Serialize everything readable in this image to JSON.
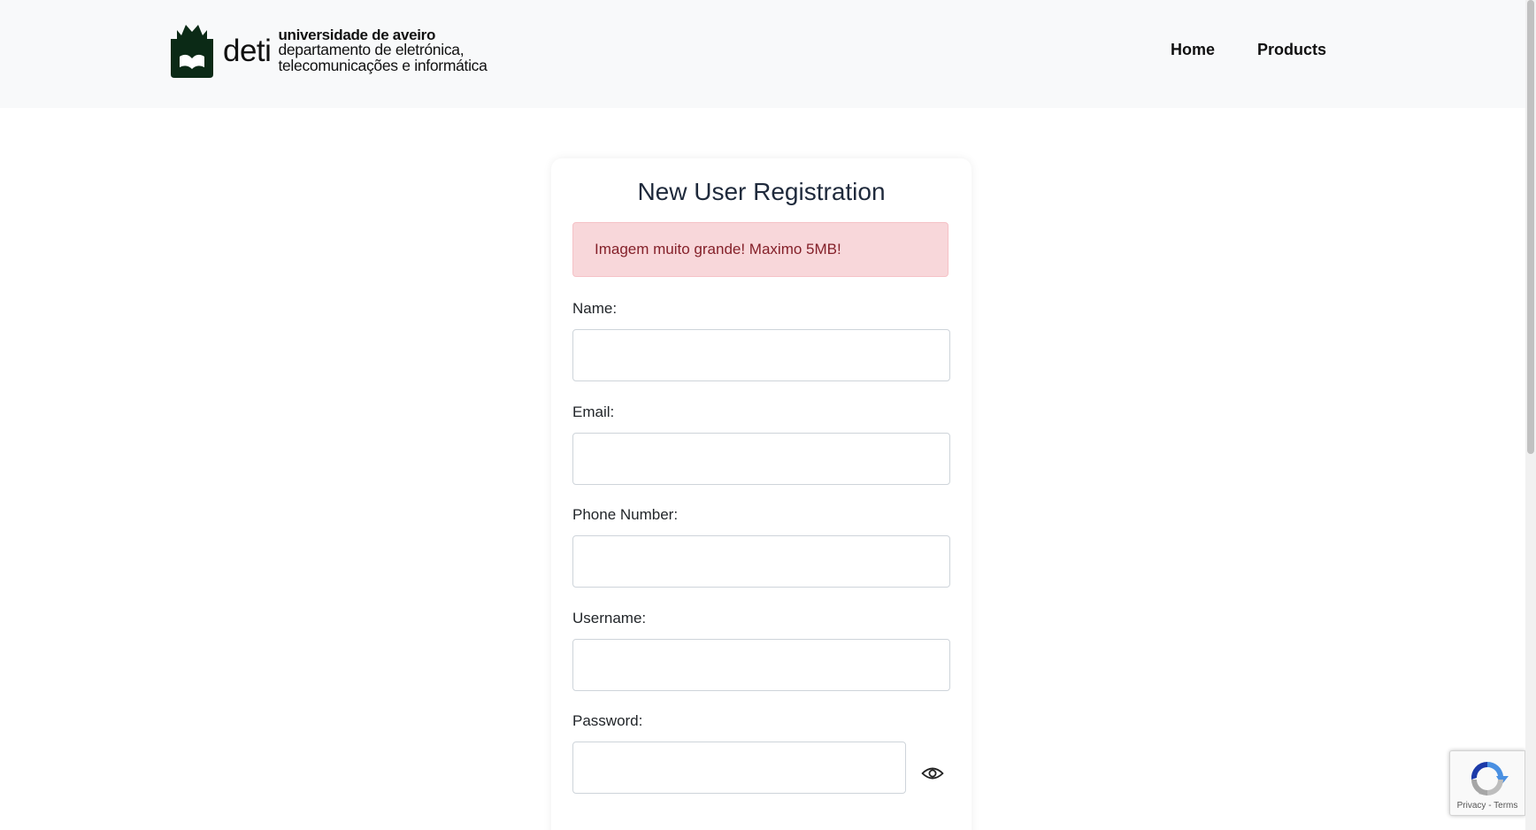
{
  "header": {
    "logo": {
      "short": "deti",
      "line1": "universidade de aveiro",
      "line2": "departamento de eletrónica,",
      "line3": "telecomunicações e informática"
    },
    "nav": [
      {
        "label": "Home"
      },
      {
        "label": "Products"
      }
    ]
  },
  "form": {
    "title": "New User Registration",
    "alert": "Imagem muito grande! Maximo 5MB!",
    "fields": {
      "name": {
        "label": "Name:",
        "value": ""
      },
      "email": {
        "label": "Email:",
        "value": ""
      },
      "phone": {
        "label": "Phone Number:",
        "value": ""
      },
      "username": {
        "label": "Username:",
        "value": ""
      },
      "password": {
        "label": "Password:",
        "value": ""
      }
    }
  },
  "recaptcha": {
    "privacy": "Privacy",
    "separator": " - ",
    "terms": "Terms"
  },
  "colors": {
    "header_bg": "#f8f9fa",
    "alert_bg": "#f8d7da",
    "alert_text": "#842029",
    "logo": "#0b2a16"
  },
  "icons": {
    "logo": "ua-castle-logo",
    "password_toggle": "eye-icon",
    "recaptcha": "recaptcha-icon"
  }
}
